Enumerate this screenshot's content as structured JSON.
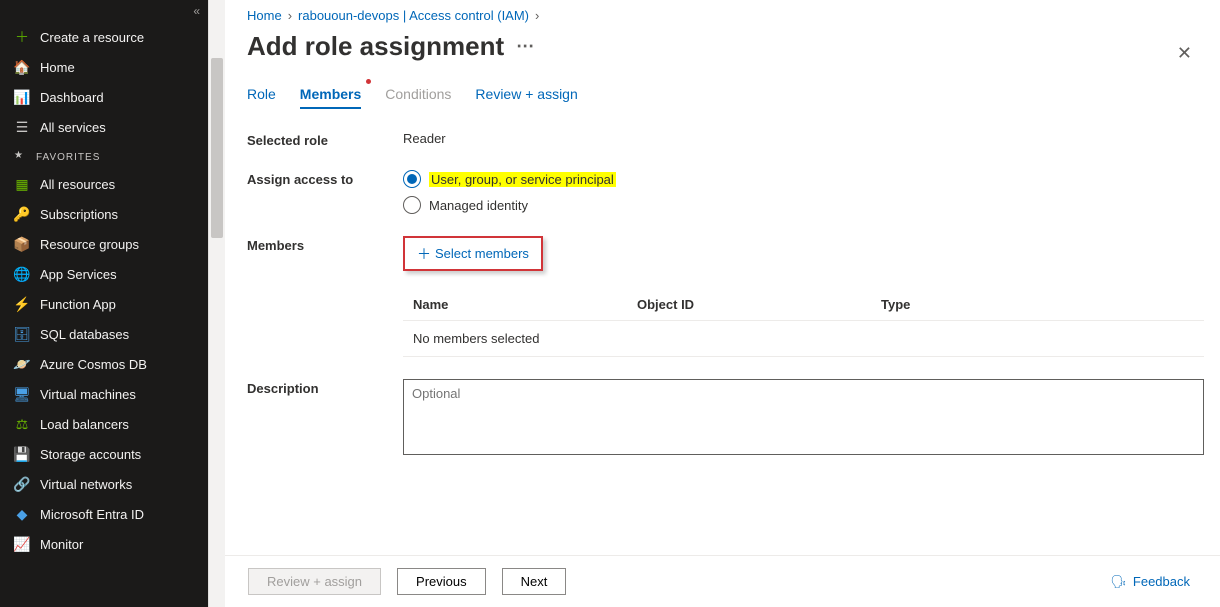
{
  "sidebar": {
    "top": [
      {
        "icon": "＋",
        "iconColor": "#57a300",
        "label": "Create a resource",
        "name": "create-resource"
      },
      {
        "icon": "🏠",
        "iconColor": "#4aa0e6",
        "label": "Home",
        "name": "home"
      },
      {
        "icon": "📊",
        "iconColor": "#4aa0e6",
        "label": "Dashboard",
        "name": "dashboard"
      },
      {
        "icon": "☰",
        "iconColor": "#c8c6c4",
        "label": "All services",
        "name": "all-services"
      }
    ],
    "favoritesHeader": "FAVORITES",
    "favorites": [
      {
        "icon": "▦",
        "iconColor": "#6bb700",
        "label": "All resources",
        "name": "all-resources"
      },
      {
        "icon": "🔑",
        "iconColor": "#ffb900",
        "label": "Subscriptions",
        "name": "subscriptions"
      },
      {
        "icon": "📦",
        "iconColor": "#8c8c8c",
        "label": "Resource groups",
        "name": "resource-groups"
      },
      {
        "icon": "🌐",
        "iconColor": "#4aa0e6",
        "label": "App Services",
        "name": "app-services"
      },
      {
        "icon": "⚡",
        "iconColor": "#ffb900",
        "label": "Function App",
        "name": "function-app"
      },
      {
        "icon": "🗄",
        "iconColor": "#4aa0e6",
        "label": "SQL databases",
        "name": "sql-databases"
      },
      {
        "icon": "🪐",
        "iconColor": "#4aa0e6",
        "label": "Azure Cosmos DB",
        "name": "cosmos-db"
      },
      {
        "icon": "🖥",
        "iconColor": "#4aa0e6",
        "label": "Virtual machines",
        "name": "virtual-machines"
      },
      {
        "icon": "⚖",
        "iconColor": "#6bb700",
        "label": "Load balancers",
        "name": "load-balancers"
      },
      {
        "icon": "💾",
        "iconColor": "#6bb700",
        "label": "Storage accounts",
        "name": "storage-accounts"
      },
      {
        "icon": "🔗",
        "iconColor": "#4aa0e6",
        "label": "Virtual networks",
        "name": "virtual-networks"
      },
      {
        "icon": "◆",
        "iconColor": "#4aa0e6",
        "label": "Microsoft Entra ID",
        "name": "entra-id"
      },
      {
        "icon": "📈",
        "iconColor": "#4aa0e6",
        "label": "Monitor",
        "name": "monitor"
      }
    ]
  },
  "breadcrumbs": [
    "Home",
    "rabououn-devops | Access control (IAM)"
  ],
  "pageTitle": "Add role assignment",
  "tabs": [
    {
      "label": "Role",
      "state": "link"
    },
    {
      "label": "Members",
      "state": "active",
      "dot": true
    },
    {
      "label": "Conditions",
      "state": "disabled"
    },
    {
      "label": "Review + assign",
      "state": "link"
    }
  ],
  "selectedRole": {
    "label": "Selected role",
    "value": "Reader"
  },
  "assignAccess": {
    "label": "Assign access to",
    "options": [
      {
        "label": "User, group, or service principal",
        "highlight": true,
        "selected": true
      },
      {
        "label": "Managed identity",
        "highlight": false,
        "selected": false
      }
    ]
  },
  "members": {
    "label": "Members",
    "selectMembers": "Select members",
    "columns": {
      "name": "Name",
      "objectId": "Object ID",
      "type": "Type"
    },
    "empty": "No members selected"
  },
  "description": {
    "label": "Description",
    "placeholder": "Optional"
  },
  "footer": {
    "reviewAssign": "Review + assign",
    "previous": "Previous",
    "next": "Next",
    "feedback": "Feedback"
  }
}
